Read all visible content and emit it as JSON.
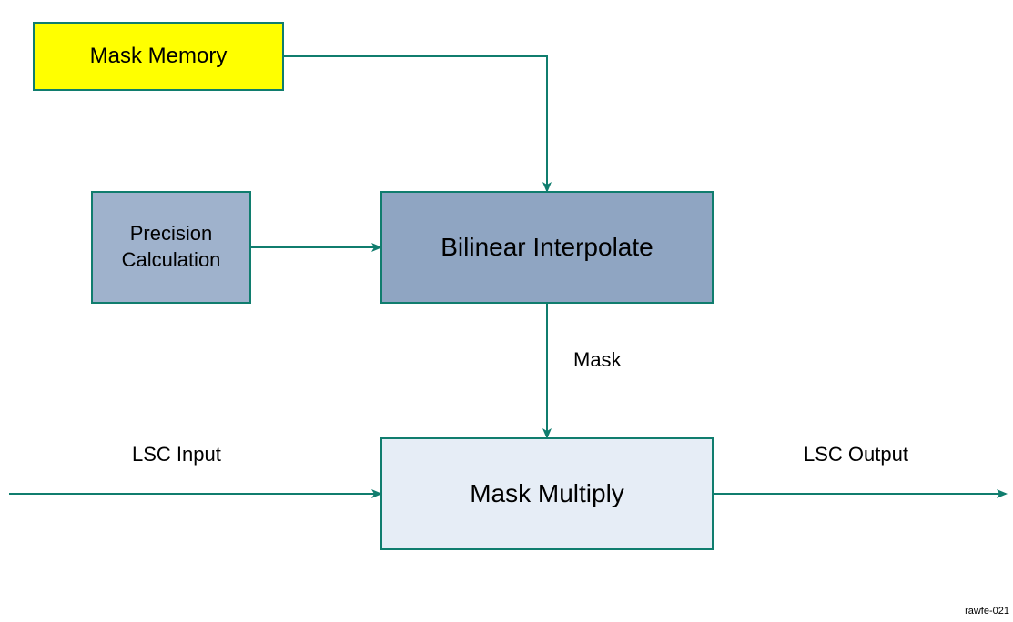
{
  "blocks": {
    "mask_memory": "Mask Memory",
    "precision": "Precision\nCalculation",
    "bilinear": "Bilinear Interpolate",
    "mask_multiply": "Mask Multiply"
  },
  "labels": {
    "mask": "Mask",
    "lsc_input": "LSC Input",
    "lsc_output": "LSC Output"
  },
  "footer_id": "rawfe-021",
  "colors": {
    "arrow": "#107d6e",
    "mask_memory_fill": "#ffff00",
    "precision_fill": "#9fb2cc",
    "bilinear_fill": "#8fa5c2",
    "mask_multiply_fill": "#e6edf6"
  }
}
